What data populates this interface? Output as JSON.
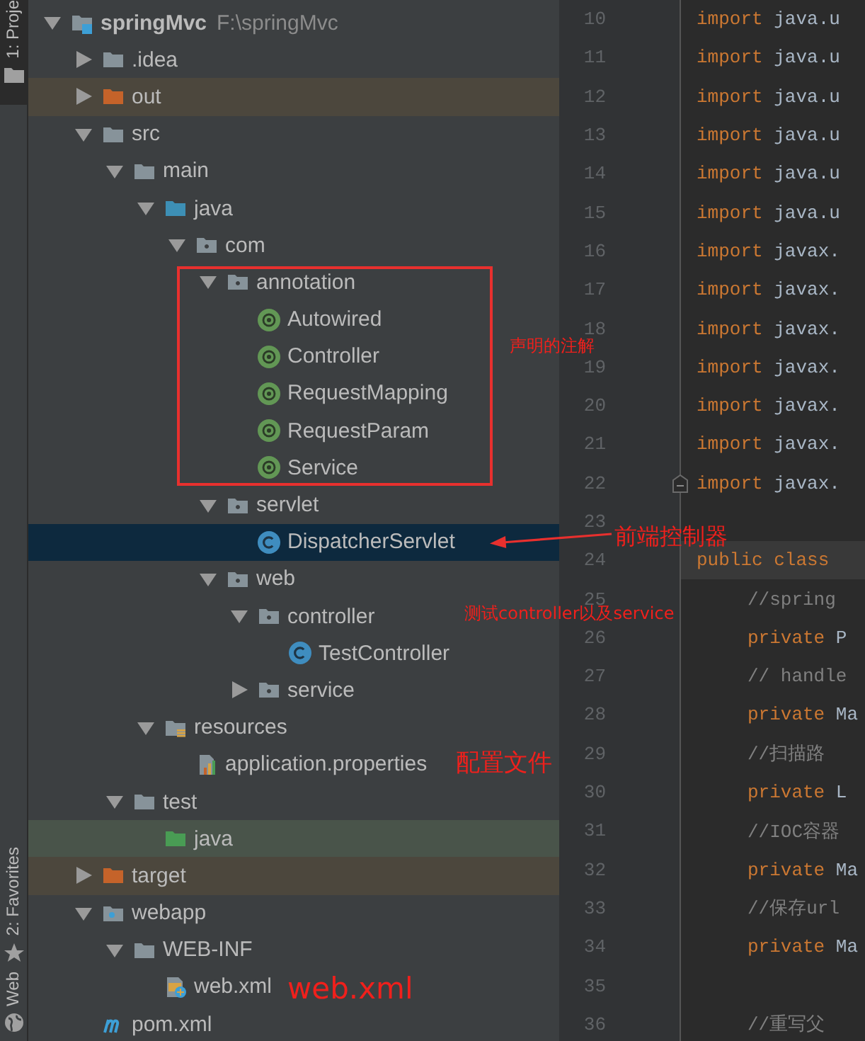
{
  "tool_tabs": [
    {
      "label": "1: Proje",
      "selected": true
    },
    {
      "label": "2: Favorites",
      "selected": false
    },
    {
      "label": "Web",
      "selected": false
    }
  ],
  "tree": [
    {
      "label": "springMvc",
      "path": "F:\\springMvc",
      "kind": "module",
      "expanded": true,
      "selected": false,
      "children": [
        {
          "label": ".idea",
          "kind": "folder",
          "expanded": false,
          "selected": false
        },
        {
          "label": "out",
          "kind": "excluded-folder",
          "expanded": false,
          "selected": false
        },
        {
          "label": "src",
          "kind": "folder",
          "expanded": true,
          "selected": false,
          "children": [
            {
              "label": "main",
              "kind": "folder",
              "expanded": true,
              "selected": false,
              "children": [
                {
                  "label": "java",
                  "kind": "source-folder",
                  "expanded": true,
                  "selected": false,
                  "children": [
                    {
                      "label": "com",
                      "kind": "package",
                      "expanded": true,
                      "selected": false,
                      "children": [
                        {
                          "label": "annotation",
                          "kind": "package",
                          "expanded": true,
                          "selected": false,
                          "children": [
                            {
                              "label": "Autowired",
                              "kind": "annotation",
                              "selected": false
                            },
                            {
                              "label": "Controller",
                              "kind": "annotation",
                              "selected": false
                            },
                            {
                              "label": "RequestMapping",
                              "kind": "annotation",
                              "selected": false
                            },
                            {
                              "label": "RequestParam",
                              "kind": "annotation",
                              "selected": false
                            },
                            {
                              "label": "Service",
                              "kind": "annotation",
                              "selected": false
                            }
                          ]
                        },
                        {
                          "label": "servlet",
                          "kind": "package",
                          "expanded": true,
                          "selected": false,
                          "children": [
                            {
                              "label": "DispatcherServlet",
                              "kind": "class",
                              "selected": true
                            }
                          ]
                        },
                        {
                          "label": "web",
                          "kind": "package",
                          "expanded": true,
                          "selected": false,
                          "children": [
                            {
                              "label": "controller",
                              "kind": "package",
                              "expanded": true,
                              "selected": false,
                              "children": [
                                {
                                  "label": "TestController",
                                  "kind": "class",
                                  "selected": false
                                }
                              ]
                            },
                            {
                              "label": "service",
                              "kind": "package",
                              "expanded": false,
                              "selected": false
                            }
                          ]
                        }
                      ]
                    }
                  ]
                },
                {
                  "label": "resources",
                  "kind": "resources-folder",
                  "expanded": true,
                  "selected": false,
                  "children": [
                    {
                      "label": "application.properties",
                      "kind": "properties",
                      "selected": false
                    }
                  ]
                }
              ]
            },
            {
              "label": "test",
              "kind": "folder",
              "expanded": true,
              "selected": false,
              "children": [
                {
                  "label": "java",
                  "kind": "test-folder",
                  "selected": false
                }
              ]
            }
          ]
        },
        {
          "label": "target",
          "kind": "excluded-folder",
          "expanded": false,
          "selected": false
        },
        {
          "label": "webapp",
          "kind": "web-folder",
          "expanded": true,
          "selected": false,
          "children": [
            {
              "label": "WEB-INF",
              "kind": "folder",
              "expanded": true,
              "selected": false,
              "children": [
                {
                  "label": "web.xml",
                  "kind": "xml",
                  "selected": false
                }
              ]
            }
          ]
        },
        {
          "label": "pom.xml",
          "kind": "maven",
          "selected": false
        }
      ]
    }
  ],
  "editor": {
    "lines": [
      {
        "number": "10",
        "current": false,
        "indent": false,
        "fold": false,
        "tokens": [
          {
            "text": "import",
            "kind": "keyword"
          },
          {
            "text": "java.u",
            "kind": "plain"
          }
        ]
      },
      {
        "number": "11",
        "current": false,
        "indent": false,
        "fold": false,
        "tokens": [
          {
            "text": "import",
            "kind": "keyword"
          },
          {
            "text": "java.u",
            "kind": "plain"
          }
        ]
      },
      {
        "number": "12",
        "current": false,
        "indent": false,
        "fold": false,
        "tokens": [
          {
            "text": "import",
            "kind": "keyword"
          },
          {
            "text": "java.u",
            "kind": "plain"
          }
        ]
      },
      {
        "number": "13",
        "current": false,
        "indent": false,
        "fold": false,
        "tokens": [
          {
            "text": "import",
            "kind": "keyword"
          },
          {
            "text": "java.u",
            "kind": "plain"
          }
        ]
      },
      {
        "number": "14",
        "current": false,
        "indent": false,
        "fold": false,
        "tokens": [
          {
            "text": "import",
            "kind": "keyword"
          },
          {
            "text": "java.u",
            "kind": "plain"
          }
        ]
      },
      {
        "number": "15",
        "current": false,
        "indent": false,
        "fold": false,
        "tokens": [
          {
            "text": "import",
            "kind": "keyword"
          },
          {
            "text": "java.u",
            "kind": "plain"
          }
        ]
      },
      {
        "number": "16",
        "current": false,
        "indent": false,
        "fold": false,
        "tokens": [
          {
            "text": "import",
            "kind": "keyword"
          },
          {
            "text": "javax.",
            "kind": "plain"
          }
        ]
      },
      {
        "number": "17",
        "current": false,
        "indent": false,
        "fold": false,
        "tokens": [
          {
            "text": "import",
            "kind": "keyword"
          },
          {
            "text": "javax.",
            "kind": "plain"
          }
        ]
      },
      {
        "number": "18",
        "current": false,
        "indent": false,
        "fold": false,
        "tokens": [
          {
            "text": "import",
            "kind": "keyword"
          },
          {
            "text": "javax.",
            "kind": "plain"
          }
        ]
      },
      {
        "number": "19",
        "current": false,
        "indent": false,
        "fold": false,
        "tokens": [
          {
            "text": "import",
            "kind": "keyword"
          },
          {
            "text": "javax.",
            "kind": "plain"
          }
        ]
      },
      {
        "number": "20",
        "current": false,
        "indent": false,
        "fold": false,
        "tokens": [
          {
            "text": "import",
            "kind": "keyword"
          },
          {
            "text": "javax.",
            "kind": "plain"
          }
        ]
      },
      {
        "number": "21",
        "current": false,
        "indent": false,
        "fold": false,
        "tokens": [
          {
            "text": "import",
            "kind": "keyword"
          },
          {
            "text": "javax.",
            "kind": "plain"
          }
        ]
      },
      {
        "number": "22",
        "current": false,
        "indent": false,
        "fold": true,
        "tokens": [
          {
            "text": "import",
            "kind": "keyword"
          },
          {
            "text": "javax.",
            "kind": "plain"
          }
        ]
      },
      {
        "number": "23",
        "current": false,
        "indent": false,
        "fold": false
      },
      {
        "number": "24",
        "current": true,
        "indent": false,
        "fold": false,
        "tokens": [
          {
            "text": "public class",
            "kind": "keyword"
          }
        ]
      },
      {
        "number": "25",
        "current": false,
        "indent": true,
        "fold": false,
        "tokens": [
          {
            "text": "//spring",
            "kind": "comment"
          }
        ]
      },
      {
        "number": "26",
        "current": false,
        "indent": true,
        "fold": false,
        "tokens": [
          {
            "text": "private",
            "kind": "keyword"
          },
          {
            "text": "P",
            "kind": "plain"
          }
        ]
      },
      {
        "number": "27",
        "current": false,
        "indent": true,
        "fold": false,
        "tokens": [
          {
            "text": "// handle",
            "kind": "comment"
          }
        ]
      },
      {
        "number": "28",
        "current": false,
        "indent": true,
        "fold": false,
        "tokens": [
          {
            "text": "private",
            "kind": "keyword"
          },
          {
            "text": "Ma",
            "kind": "plain"
          }
        ]
      },
      {
        "number": "29",
        "current": false,
        "indent": true,
        "fold": false,
        "tokens": [
          {
            "text": "//扫描路",
            "kind": "comment"
          }
        ]
      },
      {
        "number": "30",
        "current": false,
        "indent": true,
        "fold": false,
        "tokens": [
          {
            "text": "private",
            "kind": "keyword"
          },
          {
            "text": "L",
            "kind": "plain"
          }
        ]
      },
      {
        "number": "31",
        "current": false,
        "indent": true,
        "fold": false,
        "tokens": [
          {
            "text": "//IOC容器",
            "kind": "comment"
          }
        ]
      },
      {
        "number": "32",
        "current": false,
        "indent": true,
        "fold": false,
        "tokens": [
          {
            "text": "private",
            "kind": "keyword"
          },
          {
            "text": "Ma",
            "kind": "plain"
          }
        ]
      },
      {
        "number": "33",
        "current": false,
        "indent": true,
        "fold": false,
        "tokens": [
          {
            "text": "//保存url",
            "kind": "comment"
          }
        ]
      },
      {
        "number": "34",
        "current": false,
        "indent": true,
        "fold": false,
        "tokens": [
          {
            "text": "private",
            "kind": "keyword"
          },
          {
            "text": "Ma",
            "kind": "plain"
          }
        ]
      },
      {
        "number": "35",
        "current": false,
        "indent": false,
        "fold": false
      },
      {
        "number": "36",
        "current": false,
        "indent": true,
        "fold": false,
        "tokens": [
          {
            "text": "//重写父",
            "kind": "comment"
          }
        ]
      }
    ]
  },
  "callouts": [
    {
      "kind": "frame"
    },
    {
      "kind": "note",
      "text": "声明的注解"
    },
    {
      "kind": "arrow"
    },
    {
      "kind": "note",
      "text": "前端控制器"
    },
    {
      "kind": "note",
      "text": "测试controller以及service"
    },
    {
      "kind": "note",
      "text": "配置文件"
    },
    {
      "kind": "note",
      "text": "web.xml"
    }
  ]
}
